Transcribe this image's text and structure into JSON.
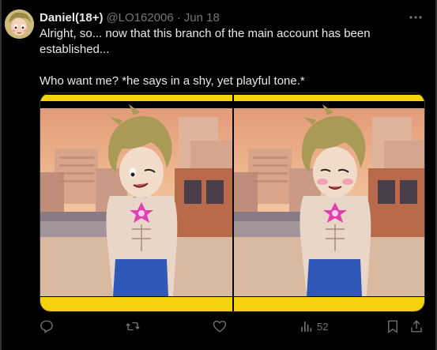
{
  "post": {
    "author_name": "Daniel(18+)",
    "handle": "@LO162006",
    "separator": "·",
    "date": "Jun 18",
    "text_line1": "Alright, so... now that this branch of the main account has been established...",
    "text_line2": "Who want me? *he says in a shy, yet playful tone.*",
    "views_count": "52"
  },
  "icons": {
    "more": "more-options-icon",
    "reply": "reply-icon",
    "repost": "repost-icon",
    "like": "heart-icon",
    "views": "views-chart-icon",
    "bookmark": "bookmark-icon",
    "share": "share-icon"
  },
  "colors": {
    "background": "#000000",
    "text_primary": "#e7e9ea",
    "text_secondary": "#71767b",
    "border": "#2f3336",
    "frame_yellow": "#f4d20b"
  }
}
